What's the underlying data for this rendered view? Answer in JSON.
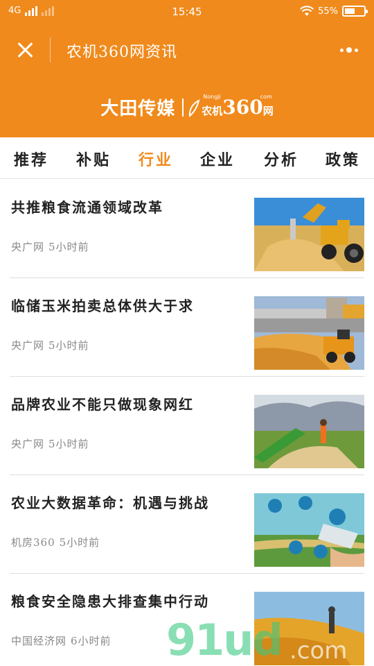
{
  "status_bar": {
    "network": "4G",
    "time": "15:45",
    "battery_percent": "55%",
    "battery_level": 0.55,
    "signal_icon": "signal-bars-icon",
    "wifi_icon": "wifi-icon"
  },
  "title_bar": {
    "title": "农机360网资讯",
    "close_icon": "close-icon",
    "more_icon": "more-dots-icon"
  },
  "banner": {
    "brand_left": "大田传媒",
    "brand_right_small": "农机",
    "brand_right_number": "360",
    "brand_right_suffix": "网",
    "brand_right_sup_left": "Nongji",
    "brand_right_sup_right": "com"
  },
  "tabs": [
    {
      "label": "推荐",
      "active": false
    },
    {
      "label": "补贴",
      "active": false
    },
    {
      "label": "行业",
      "active": true
    },
    {
      "label": "企业",
      "active": false
    },
    {
      "label": "分析",
      "active": false
    },
    {
      "label": "政策",
      "active": false
    }
  ],
  "news": [
    {
      "headline": "共推粮食流通领域改革",
      "source": "央广网",
      "time": "5小时前"
    },
    {
      "headline": "临储玉米拍卖总体供大于求",
      "source": "央广网",
      "time": "5小时前"
    },
    {
      "headline": "品牌农业不能只做现象网红",
      "source": "央广网",
      "time": "5小时前"
    },
    {
      "headline": "农业大数据革命：机遇与挑战",
      "source": "机房360",
      "time": "5小时前"
    },
    {
      "headline": "粮食安全隐患大排查集中行动",
      "source": "中国经济网",
      "time": "6小时前"
    }
  ],
  "watermark": {
    "text": "91ud",
    "suffix": ".com"
  },
  "colors": {
    "accent": "#f08a1c",
    "text": "#222222",
    "meta": "#888888"
  }
}
